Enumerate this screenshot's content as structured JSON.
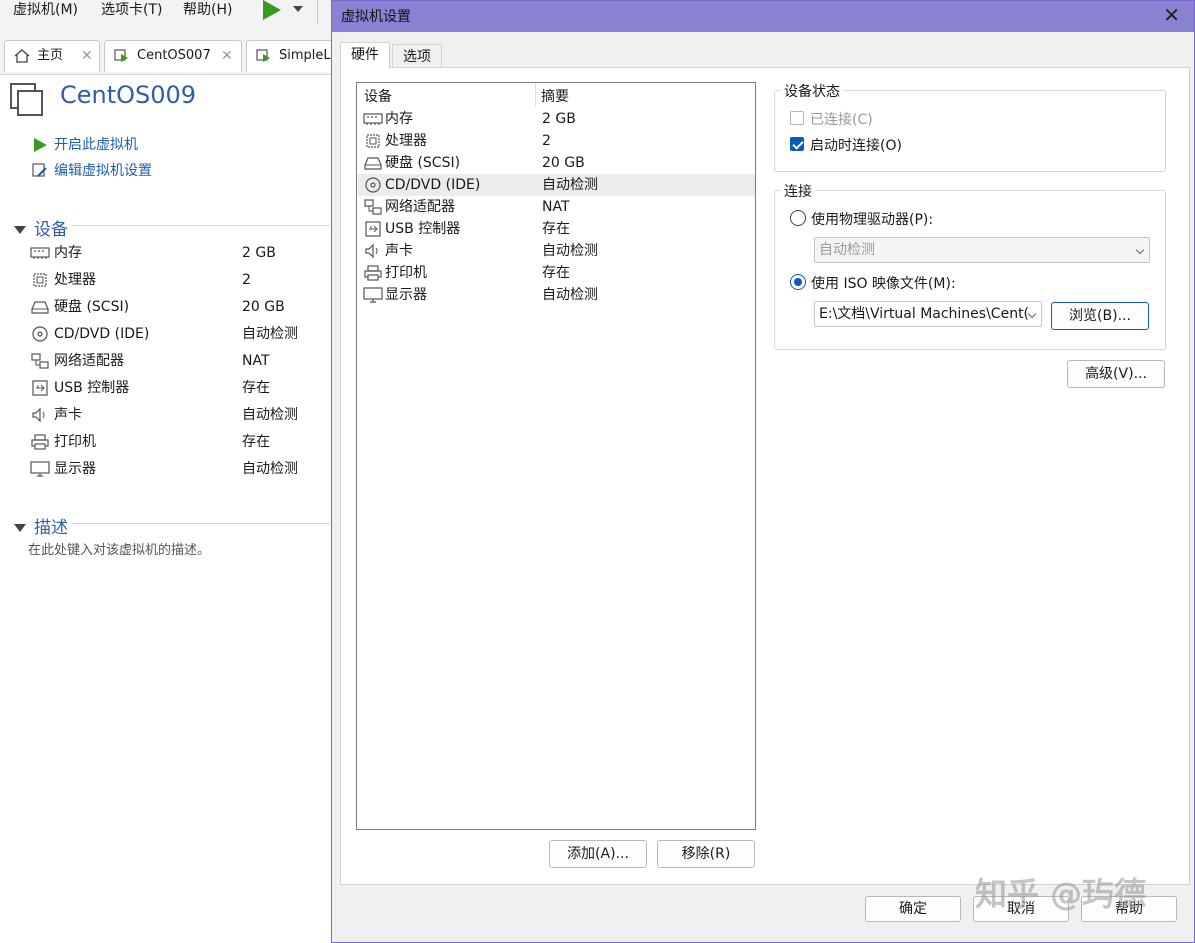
{
  "menubar": {
    "items": [
      "虚拟机(M)",
      "选项卡(T)",
      "帮助(H)"
    ]
  },
  "tabs": [
    {
      "label": "主页",
      "icon": "home-icon"
    },
    {
      "label": "CentOS007",
      "icon": "vm-icon"
    },
    {
      "label": "SimpleLin",
      "icon": "vm-icon"
    }
  ],
  "vm": {
    "title": "CentOS009",
    "actions": [
      "开启此虚拟机",
      "编辑虚拟机设置"
    ],
    "devices_heading": "设备",
    "devices": [
      {
        "name": "内存",
        "summary": "2 GB",
        "icon": "memory-icon"
      },
      {
        "name": "处理器",
        "summary": "2",
        "icon": "cpu-icon"
      },
      {
        "name": "硬盘 (SCSI)",
        "summary": "20 GB",
        "icon": "harddisk-icon"
      },
      {
        "name": "CD/DVD (IDE)",
        "summary": "自动检测",
        "icon": "cd-icon"
      },
      {
        "name": "网络适配器",
        "summary": "NAT",
        "icon": "network-icon"
      },
      {
        "name": "USB 控制器",
        "summary": "存在",
        "icon": "usb-icon"
      },
      {
        "name": "声卡",
        "summary": "自动检测",
        "icon": "sound-icon"
      },
      {
        "name": "打印机",
        "summary": "存在",
        "icon": "printer-icon"
      },
      {
        "name": "显示器",
        "summary": "自动检测",
        "icon": "display-icon"
      }
    ],
    "description_heading": "描述",
    "description_placeholder": "在此处键入对该虚拟机的描述。"
  },
  "dialog": {
    "title": "虚拟机设置",
    "tabs": [
      "硬件",
      "选项"
    ],
    "list_headers": {
      "device": "设备",
      "summary": "摘要"
    },
    "selected_index": 3,
    "add_button": "添加(A)...",
    "remove_button": "移除(R)",
    "device_status": {
      "title": "设备状态",
      "connected_label": "已连接(C)",
      "connected": false,
      "connect_on_start_label": "启动时连接(O)",
      "connect_on_start": true
    },
    "connection": {
      "title": "连接",
      "physical_label": "使用物理驱动器(P):",
      "physical_selected": false,
      "physical_value": "自动检测",
      "iso_label": "使用 ISO 映像文件(M):",
      "iso_selected": true,
      "iso_path": "E:\\文档\\Virtual Machines\\Cent(",
      "browse_button": "浏览(B)..."
    },
    "advanced_button": "高级(V)...",
    "ok_button": "确定",
    "cancel_button": "取消",
    "help_button": "帮助"
  },
  "watermark": "知乎 @玙德",
  "colors": {
    "dialog_titlebar": "#8a83d3",
    "accent_blue": "#0a5bbd",
    "link_blue": "#1f5ea8",
    "play_green": "#3a9a1f"
  }
}
